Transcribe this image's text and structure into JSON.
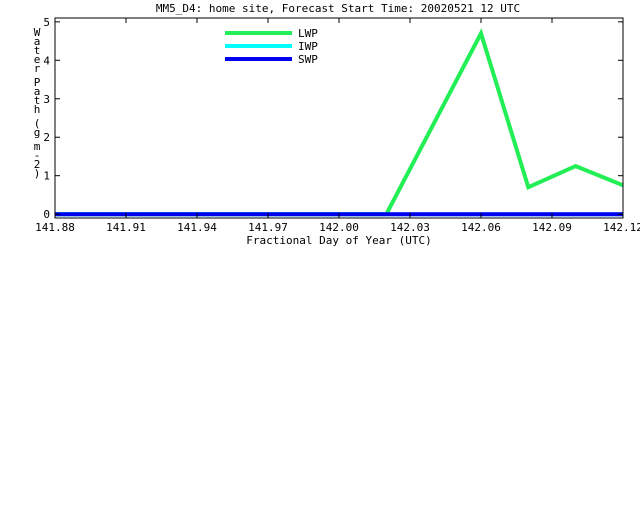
{
  "chart_data": {
    "type": "line",
    "title": "MM5_D4: home site,  Forecast Start Time: 20020521 12 UTC",
    "xlabel": "Fractional Day of Year (UTC)",
    "ylabel": "Water Path (g m-2)",
    "ylabel_chars": [
      "W",
      "a",
      "t",
      "e",
      "r",
      "",
      "P",
      "a",
      "t",
      "h",
      "",
      "(",
      "g",
      "",
      "m",
      "-",
      "2",
      ")"
    ],
    "xlim": [
      141.88,
      142.12
    ],
    "ylim": [
      -0.1,
      5.1
    ],
    "x_ticks": [
      141.88,
      141.91,
      141.94,
      141.97,
      142.0,
      142.03,
      142.06,
      142.09,
      142.12
    ],
    "x_tick_labels": [
      "141.88",
      "141.91",
      "141.94",
      "141.97",
      "142.00",
      "142.03",
      "142.06",
      "142.09",
      "142.12"
    ],
    "y_ticks": [
      0,
      1,
      2,
      3,
      4,
      5
    ],
    "y_tick_labels": [
      "0",
      "1",
      "2",
      "3",
      "4",
      "5"
    ],
    "grid": false,
    "legend_position": "top-left",
    "series": [
      {
        "name": "LWP",
        "color": "#22ee55",
        "x": [
          141.88,
          142.02,
          142.06,
          142.08,
          142.1,
          142.12
        ],
        "y": [
          0,
          0,
          4.7,
          0.7,
          1.25,
          0.75
        ]
      },
      {
        "name": "IWP",
        "color": "#00ffff",
        "x": [
          141.88,
          142.12
        ],
        "y": [
          0,
          0
        ]
      },
      {
        "name": "SWP",
        "color": "#0000ee",
        "x": [
          141.88,
          142.12
        ],
        "y": [
          0,
          0
        ]
      }
    ]
  }
}
